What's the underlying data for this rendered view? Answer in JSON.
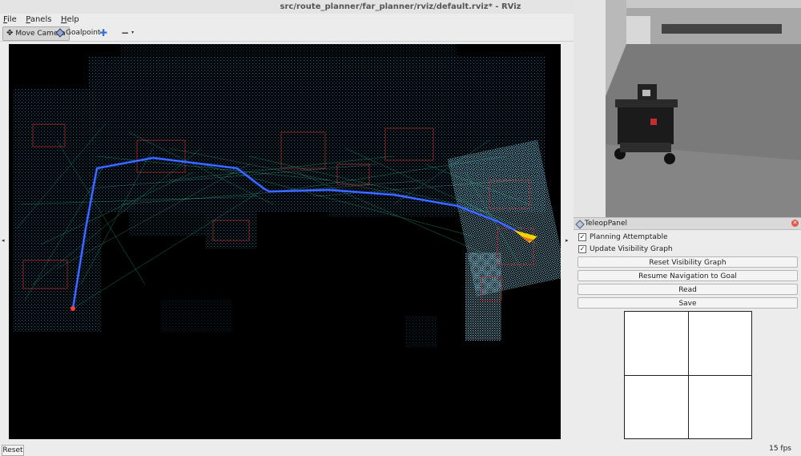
{
  "window": {
    "title": "src/route_planner/far_planner/rviz/default.rviz* - RViz"
  },
  "menu": [
    {
      "label": "File",
      "key": "F",
      "rest": "ile"
    },
    {
      "label": "Panels",
      "key": "P",
      "rest": "anels"
    },
    {
      "label": "Help",
      "key": "H",
      "rest": "elp"
    }
  ],
  "toolbar": {
    "move_camera": "Move Camera",
    "goalpoint": "Goalpoint"
  },
  "teleop": {
    "title": "TeleopPanel",
    "planning_attemptable": "Planning Attemptable",
    "update_visibility_graph": "Update Visibility Graph",
    "reset_visibility_graph": "Reset Visibility Graph",
    "resume_navigation": "Resume Navigation to Goal",
    "read": "Read",
    "save": "Save"
  },
  "status": {
    "reset": "Reset",
    "fps": "15 fps"
  },
  "colors": {
    "path": "#1e4fff",
    "graph": "#2fd0a0",
    "map": "#2b8fb3",
    "goal": "#f2d200"
  }
}
